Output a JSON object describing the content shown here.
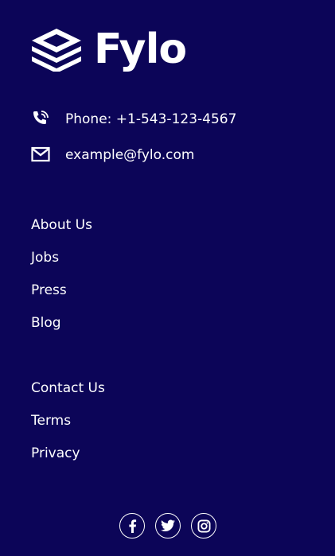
{
  "brand": {
    "name": "Fylo",
    "logo_icon": "stacked-layers-icon"
  },
  "contact": {
    "phone_icon": "phone-icon",
    "phone": "Phone: +1-543-123-4567",
    "email_icon": "email-icon",
    "email": "example@fylo.com"
  },
  "links_primary": [
    "About Us",
    "Jobs",
    "Press",
    "Blog"
  ],
  "links_secondary": [
    "Contact Us",
    "Terms",
    "Privacy"
  ],
  "social": [
    {
      "name": "facebook",
      "icon": "facebook-icon"
    },
    {
      "name": "twitter",
      "icon": "twitter-icon"
    },
    {
      "name": "instagram",
      "icon": "instagram-icon"
    }
  ],
  "colors": {
    "background": "#0c0558",
    "text": "#ffffff"
  }
}
